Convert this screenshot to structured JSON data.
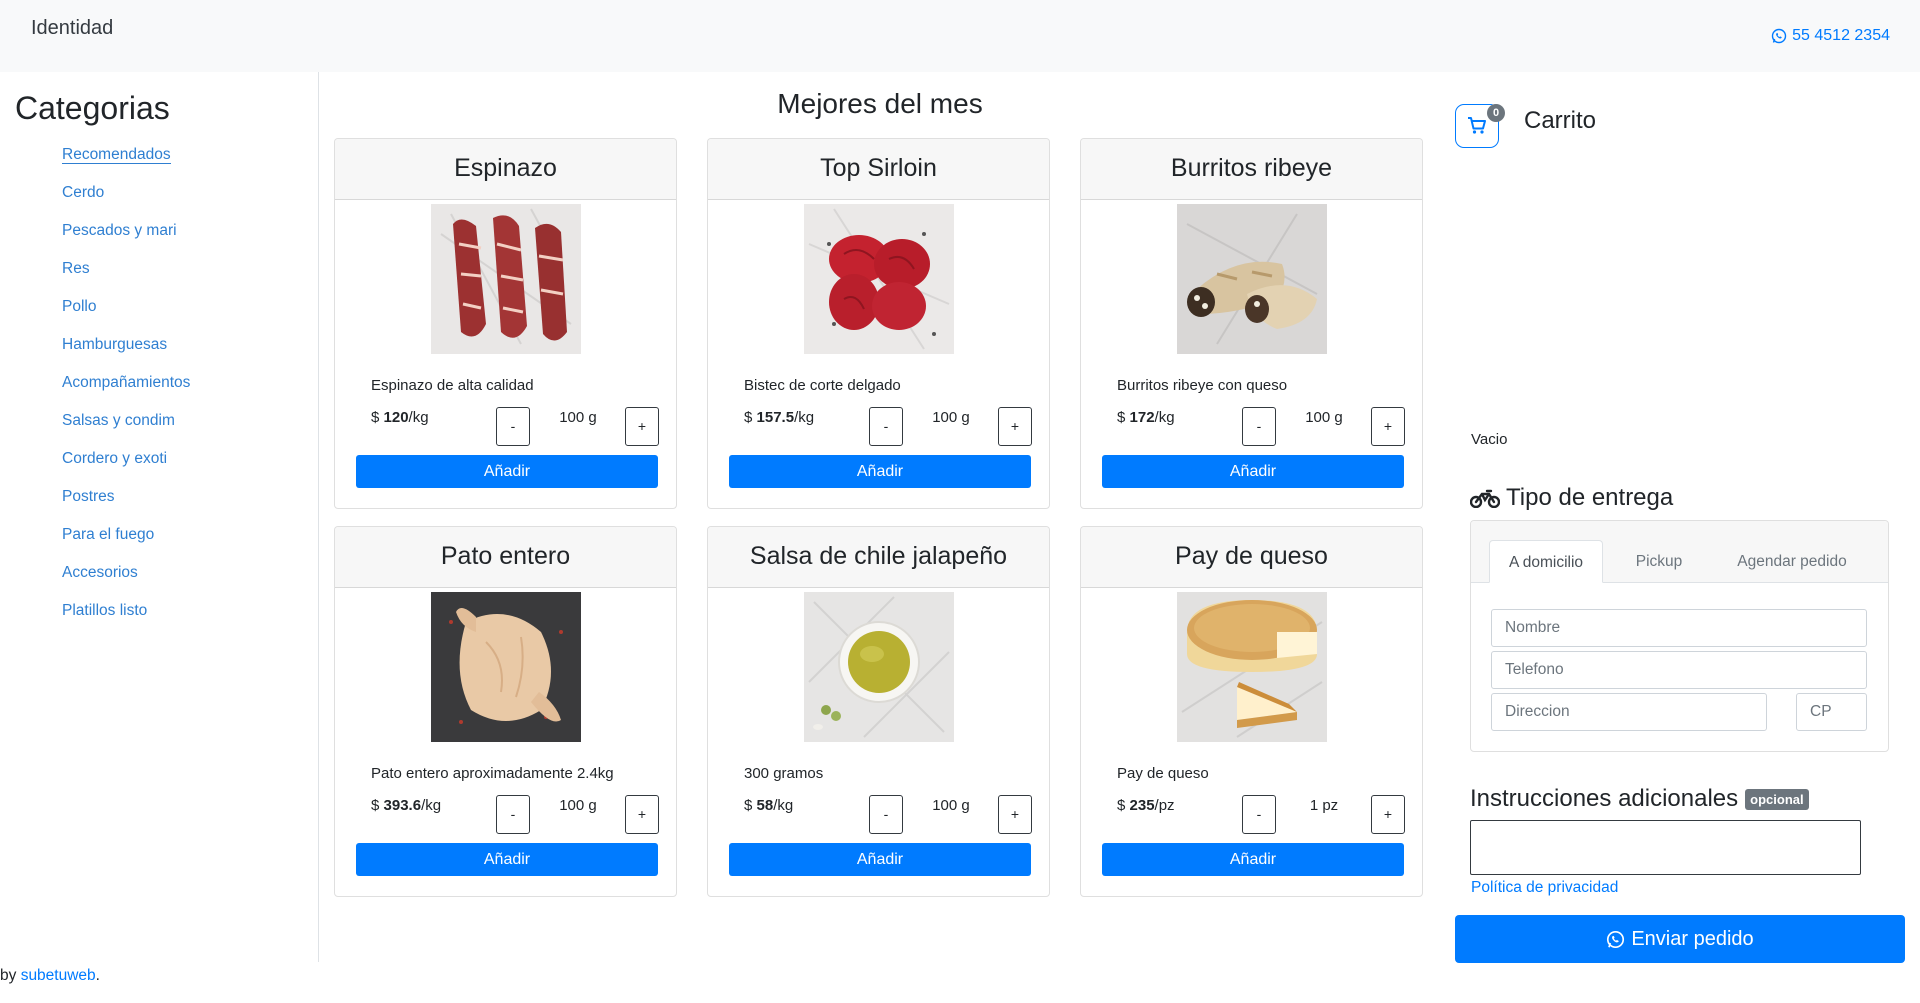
{
  "header": {
    "brand": "Identidad",
    "phone": "55 4512 2354"
  },
  "sidebar": {
    "title": "Categorias",
    "items": [
      {
        "label": "Recomendados"
      },
      {
        "label": "Cerdo"
      },
      {
        "label": "Pescados y mari"
      },
      {
        "label": "Res"
      },
      {
        "label": "Pollo"
      },
      {
        "label": "Hamburguesas"
      },
      {
        "label": "Acompañamientos"
      },
      {
        "label": "Salsas y condim"
      },
      {
        "label": "Cordero y exoti"
      },
      {
        "label": "Postres"
      },
      {
        "label": "Para el fuego"
      },
      {
        "label": "Accesorios"
      },
      {
        "label": "Platillos listo"
      }
    ]
  },
  "main": {
    "title": "Mejores del mes",
    "products": [
      {
        "name": "Espinazo",
        "desc": "Espinazo de alta calidad",
        "currency": "$ ",
        "price": "120",
        "unit": "/kg",
        "qty": "100 g",
        "minus": "-",
        "plus": "+",
        "add": "Añadir",
        "image": "raw-meat-cuts"
      },
      {
        "name": "Top Sirloin",
        "desc": "Bistec de corte delgado",
        "currency": "$ ",
        "price": "157.5",
        "unit": "/kg",
        "qty": "100 g",
        "minus": "-",
        "plus": "+",
        "add": "Añadir",
        "image": "red-steak-slices"
      },
      {
        "name": "Burritos ribeye",
        "desc": "Burritos ribeye con queso",
        "currency": "$ ",
        "price": "172",
        "unit": "/kg",
        "qty": "100 g",
        "minus": "-",
        "plus": "+",
        "add": "Añadir",
        "image": "burritos"
      },
      {
        "name": "Pato entero",
        "desc": "Pato entero aproximadamente 2.4kg",
        "currency": "$ ",
        "price": "393.6",
        "unit": "/kg",
        "qty": "100 g",
        "minus": "-",
        "plus": "+",
        "add": "Añadir",
        "image": "whole-duck"
      },
      {
        "name": "Salsa de chile jalapeño",
        "desc": "300 gramos",
        "currency": "$ ",
        "price": "58",
        "unit": "/kg",
        "qty": "100 g",
        "minus": "-",
        "plus": "+",
        "add": "Añadir",
        "image": "sauce-bowl"
      },
      {
        "name": "Pay de queso",
        "desc": "Pay de queso",
        "currency": "$ ",
        "price": "235",
        "unit": "/pz",
        "qty": "1 pz",
        "minus": "-",
        "plus": "+",
        "add": "Añadir",
        "image": "cheesecake"
      }
    ]
  },
  "cart": {
    "title": "Carrito",
    "count": "0",
    "empty": "Vacio"
  },
  "delivery": {
    "title": "Tipo de entrega",
    "tabs": [
      "A domicilio",
      "Pickup",
      "Agendar pedido"
    ],
    "fields": {
      "name": "Nombre",
      "phone": "Telefono",
      "address": "Direccion",
      "cp": "CP"
    }
  },
  "instructions": {
    "title": "Instrucciones adicionales",
    "badge": "opcional",
    "privacy": "Política de privacidad",
    "send": "Enviar pedido"
  },
  "footer": {
    "prefix": "by ",
    "link": "subetuweb",
    "suffix": "."
  },
  "colors": {
    "primary": "#007bff",
    "secondary": "#6c757d",
    "header_bg": "#f8f9fa"
  }
}
